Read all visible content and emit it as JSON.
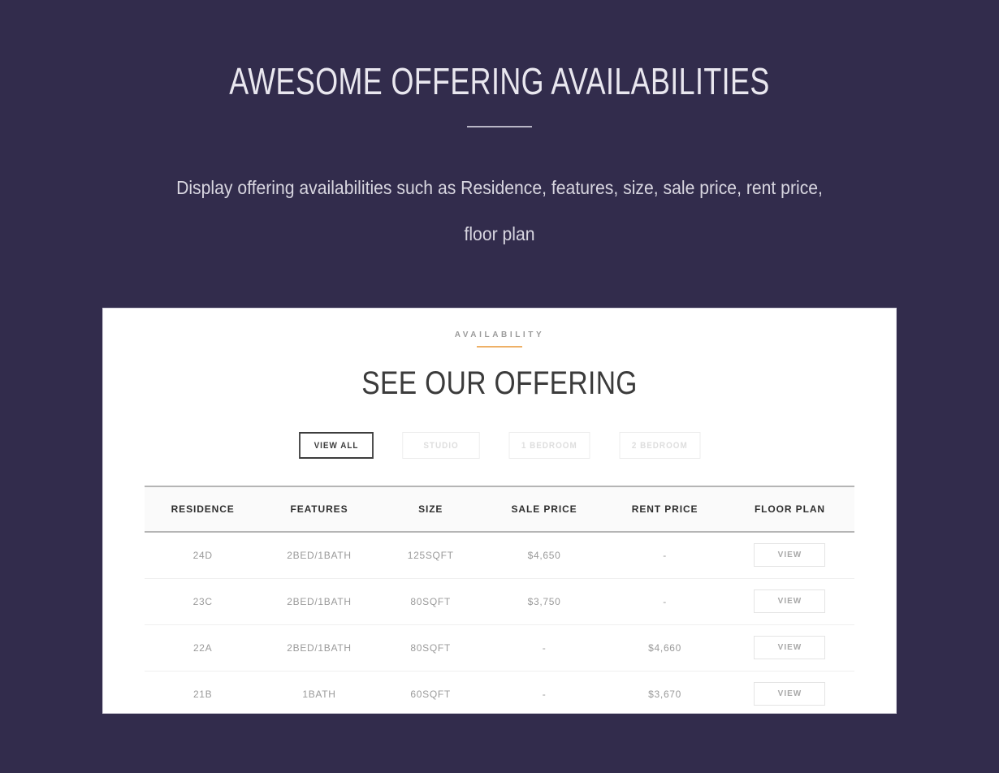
{
  "hero": {
    "title": "AWESOME OFFERING AVAILABILITIES",
    "subtitle": "Display offering availabilities such as Residence, features, size, sale price, rent price, floor plan"
  },
  "card": {
    "eyebrow": "AVAILABILITY",
    "title": "SEE OUR OFFERING",
    "accent_color": "#eeb066",
    "filters": [
      {
        "label": "VIEW ALL",
        "active": true
      },
      {
        "label": "STUDIO",
        "active": false
      },
      {
        "label": "1 BEDROOM",
        "active": false
      },
      {
        "label": "2 BEDROOM",
        "active": false
      }
    ],
    "table": {
      "columns": [
        "RESIDENCE",
        "FEATURES",
        "SIZE",
        "SALE PRICE",
        "RENT PRICE",
        "FLOOR PLAN"
      ],
      "view_label": "VIEW",
      "empty_mark": "-",
      "rows": [
        {
          "residence": "24D",
          "features": "2BED/1BATH",
          "size": "125SQFT",
          "sale_price": "$4,650",
          "rent_price": "-",
          "floor_plan": "VIEW"
        },
        {
          "residence": "23C",
          "features": "2BED/1BATH",
          "size": "80SQFT",
          "sale_price": "$3,750",
          "rent_price": "-",
          "floor_plan": "VIEW"
        },
        {
          "residence": "22A",
          "features": "2BED/1BATH",
          "size": "80SQFT",
          "sale_price": "-",
          "rent_price": "$4,660",
          "floor_plan": "VIEW"
        },
        {
          "residence": "21B",
          "features": "1BATH",
          "size": "60SQFT",
          "sale_price": "-",
          "rent_price": "$3,670",
          "floor_plan": "VIEW"
        }
      ]
    }
  },
  "theme": {
    "background": "#322c4c",
    "card_background": "#ffffff",
    "heading_color": "#e9e7ef",
    "accent": "#eeb066"
  }
}
